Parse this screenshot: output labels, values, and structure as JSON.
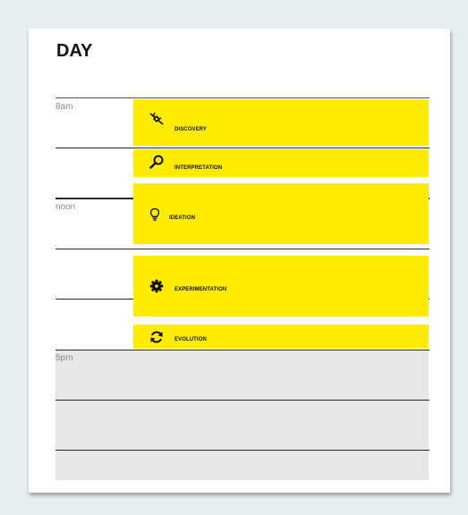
{
  "page": {
    "title": "DAY",
    "colors": {
      "background": "#e5eff2",
      "card": "#ffffff",
      "block": "#ffec00",
      "evening": "#e6e7e8"
    }
  },
  "times": {
    "t8am": "8am",
    "noon": "noon",
    "t5pm": "5pm"
  },
  "blocks": [
    {
      "label": "DISCOVERY",
      "icon": "compass-icon"
    },
    {
      "label": "INTERPRETATION",
      "icon": "magnifier-icon"
    },
    {
      "label": "IDEATION",
      "icon": "lightbulb-icon"
    },
    {
      "label": "EXPERIMENTATION",
      "icon": "gear-icon"
    },
    {
      "label": "EVOLUTION",
      "icon": "refresh-icon"
    }
  ]
}
